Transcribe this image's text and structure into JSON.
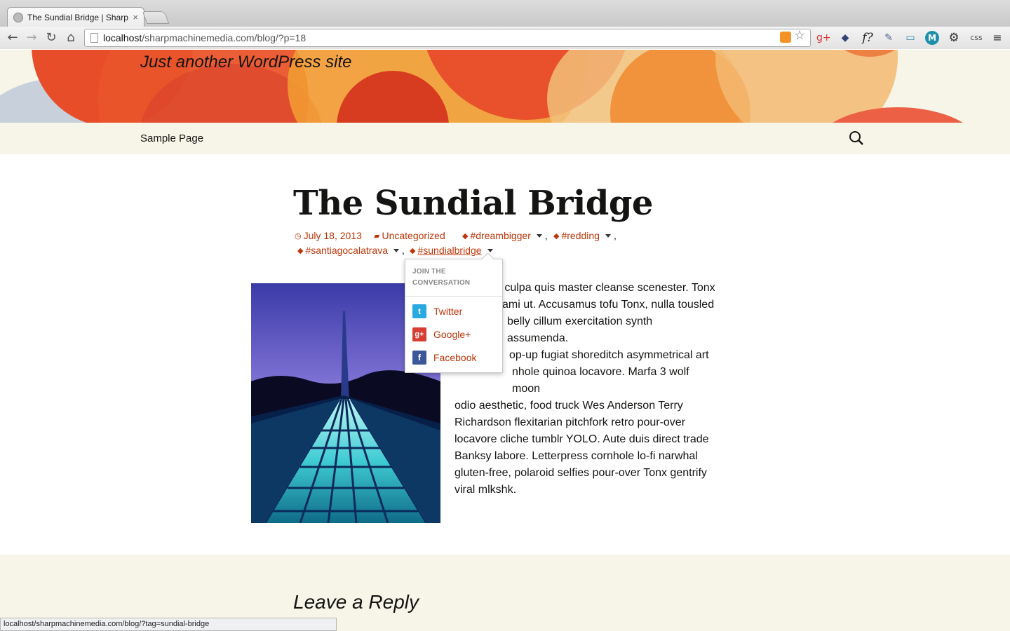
{
  "browser": {
    "tab_title": "The Sundial Bridge | Sharp",
    "tab_close": "×",
    "url_host": "localhost",
    "url_path": "/sharpmachinemedia.com/blog/?p=18",
    "status_url": "localhost/sharpmachinemedia.com/blog/?tag=sundial-bridge",
    "ext_css_label": "css"
  },
  "site": {
    "tagline": "Just another WordPress site",
    "nav": [
      "Sample Page"
    ]
  },
  "post": {
    "title": "The Sundial Bridge",
    "date": "July 18, 2013",
    "category": "Uncategorized",
    "tags": [
      "#dreambigger",
      "#redding",
      "#santiagocalatrava",
      "#sundialbridge"
    ],
    "tag_separator": ",",
    "body_lines": [
      "n culpa quis master cleanse scenester. Tonx",
      "ami ut. Accusamus tofu Tonx, nulla tousled",
      "belly cillum exercitation synth assumenda.",
      "op-up fugiat shoreditch asymmetrical art",
      "nhole quinoa locavore. Marfa 3 wolf moon",
      "odio aesthetic, food truck Wes Anderson Terry",
      "Richardson flexitarian pitchfork retro pour-over",
      "locavore cliche tumblr YOLO. Aute duis direct trade",
      "Banksy labore. Letterpress cornhole lo-fi narwhal",
      "gluten-free, polaroid selfies pour-over Tonx gentrify",
      "viral mlkshk."
    ]
  },
  "share_menu": {
    "heading": "JOIN THE CONVERSATION",
    "items": [
      {
        "label": "Twitter",
        "icon": "twitter-icon",
        "color": "#29a9e1"
      },
      {
        "label": "Google+",
        "icon": "google-plus-icon",
        "color": "#d73d32"
      },
      {
        "label": "Facebook",
        "icon": "facebook-icon",
        "color": "#3b5998"
      }
    ]
  },
  "comments": {
    "title": "Leave a Reply"
  },
  "colors": {
    "link": "#bc360a",
    "banner_bg": "#f7f5e8",
    "text": "#141412"
  }
}
